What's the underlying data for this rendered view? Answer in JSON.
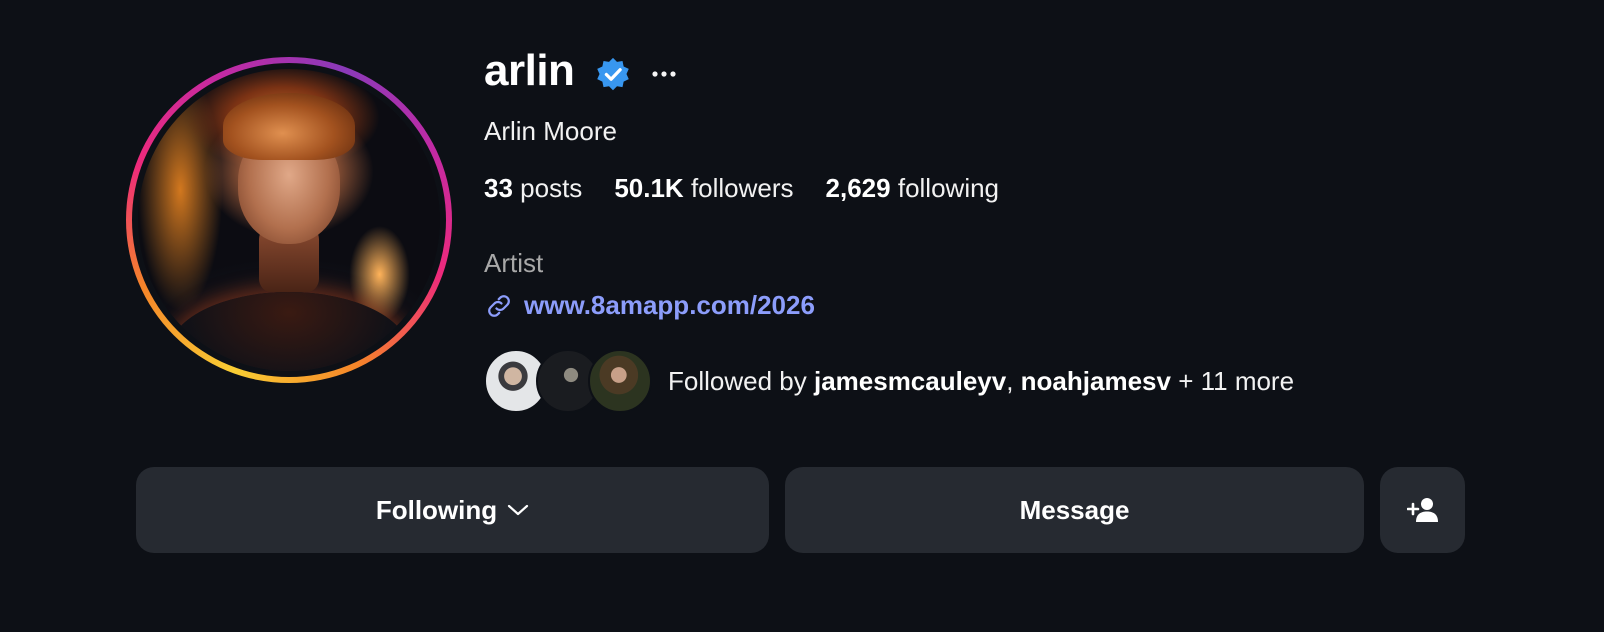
{
  "profile": {
    "username": "arlin",
    "verified": true,
    "full_name": "Arlin Moore",
    "category": "Artist",
    "link": "www.8amapp.com/2026"
  },
  "stats": {
    "posts_count": "33",
    "posts_label": "posts",
    "followers_count": "50.1K",
    "followers_label": "followers",
    "following_count": "2,629",
    "following_label": "following"
  },
  "followed_by": {
    "prefix": "Followed by ",
    "user1": "jamesmcauleyv",
    "separator": ", ",
    "user2": "noahjamesv",
    "suffix": " + 11 more"
  },
  "buttons": {
    "following_label": "Following",
    "message_label": "Message"
  },
  "icons": {
    "verified": "verified-badge-icon",
    "more": "more-options-icon",
    "link": "link-icon",
    "chevron": "chevron-down-icon",
    "add_person": "add-person-icon"
  },
  "colors": {
    "background": "#0d1016",
    "verified_blue": "#3897f0",
    "link": "#8c9dfb",
    "button_bg": "#262a31",
    "muted_text": "#a8a8a8"
  }
}
